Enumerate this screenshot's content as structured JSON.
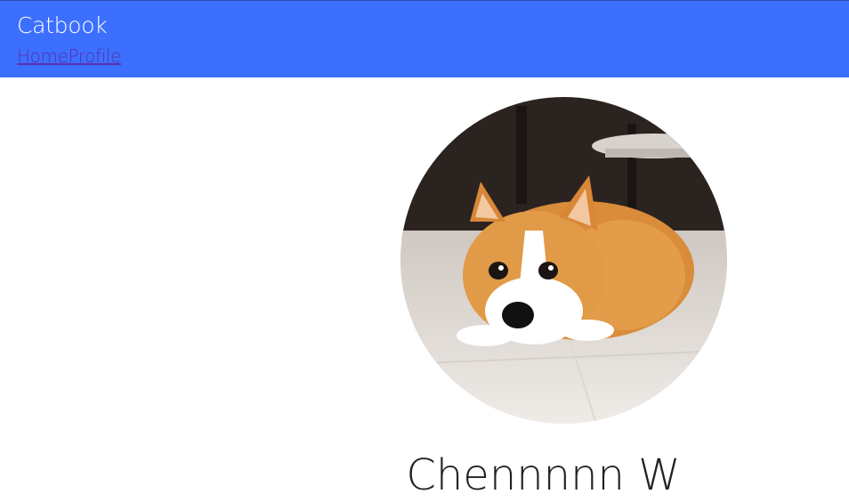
{
  "header": {
    "brand": "Catbook",
    "nav": [
      {
        "label": "Home"
      },
      {
        "label": "Profile"
      }
    ]
  },
  "profile": {
    "avatar_icon": "corgi-photo",
    "name": "Chennnnn W"
  },
  "colors": {
    "header_bg": "#3d6fff",
    "link_visited": "#5b2fb0"
  }
}
